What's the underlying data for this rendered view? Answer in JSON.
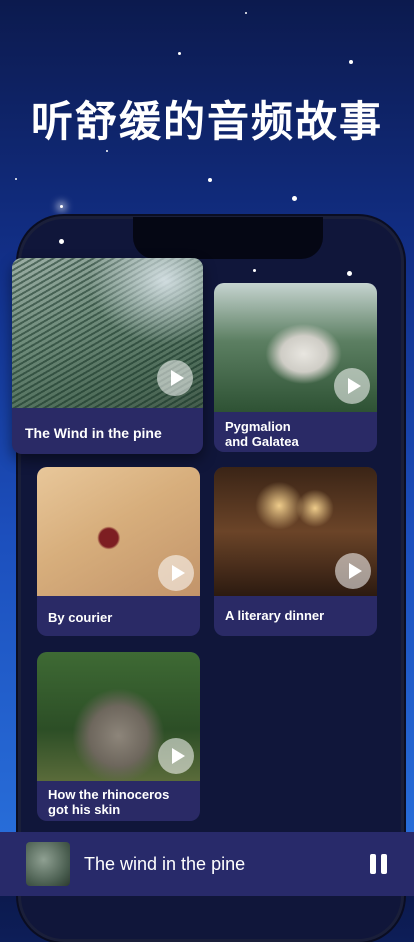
{
  "headline": "听舒缓的音频故事",
  "stories": [
    {
      "title": "The Wind in the pine"
    },
    {
      "title": "Pygmalion\nand Galatea"
    },
    {
      "title": "By courier"
    },
    {
      "title": "A literary dinner"
    },
    {
      "title": "How the rhinoceros\ngot his skin"
    }
  ],
  "player": {
    "title": "The wind in the pine",
    "thumbnail_icon": "pine-thumbnail",
    "control_icon": "pause-icon"
  },
  "colors": {
    "card": "#2a2a66",
    "player": "#282a6a",
    "phone": "#10163a"
  }
}
